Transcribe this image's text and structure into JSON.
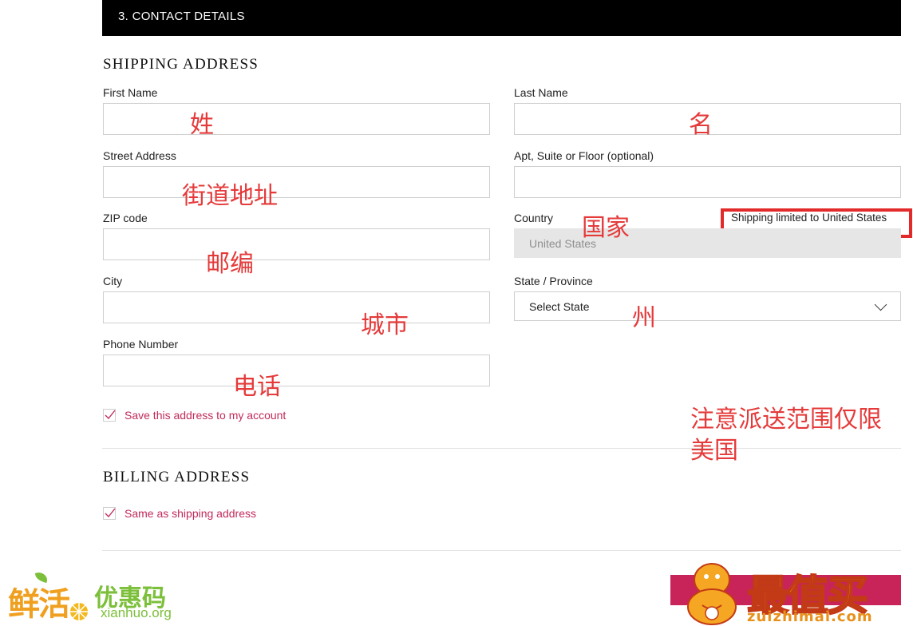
{
  "section": {
    "title": "3. CONTACT DETAILS"
  },
  "shipping": {
    "heading": "SHIPPING ADDRESS",
    "first_name_label": "First Name",
    "last_name_label": "Last Name",
    "street_label": "Street Address",
    "apt_label": "Apt, Suite or Floor (optional)",
    "zip_label": "ZIP code",
    "country_label": "Country",
    "country_value": "United States",
    "country_note": "Shipping limited to United States",
    "city_label": "City",
    "state_label": "State / Province",
    "state_value": "Select State",
    "phone_label": "Phone Number",
    "save_address_label": "Save this address to my account"
  },
  "billing": {
    "heading": "BILLING ADDRESS",
    "same_as_label": "Same as shipping address"
  },
  "annotations": {
    "first_name": "姓",
    "last_name": "名",
    "street": "街道地址",
    "country": "国家",
    "zip": "邮编",
    "city": "城市",
    "state": "州",
    "phone": "电话",
    "note_line1": "注意派送范围仅限",
    "note_line2": "美国"
  },
  "watermarks": {
    "left_logo": "鲜活优惠码",
    "left_url": "xianhuo.org",
    "right_logo": "最值买",
    "right_url": "zuizhimai.com"
  },
  "colors": {
    "accent": "#c22a5a",
    "annotation": "#e53a3a",
    "bar": "#000000"
  }
}
